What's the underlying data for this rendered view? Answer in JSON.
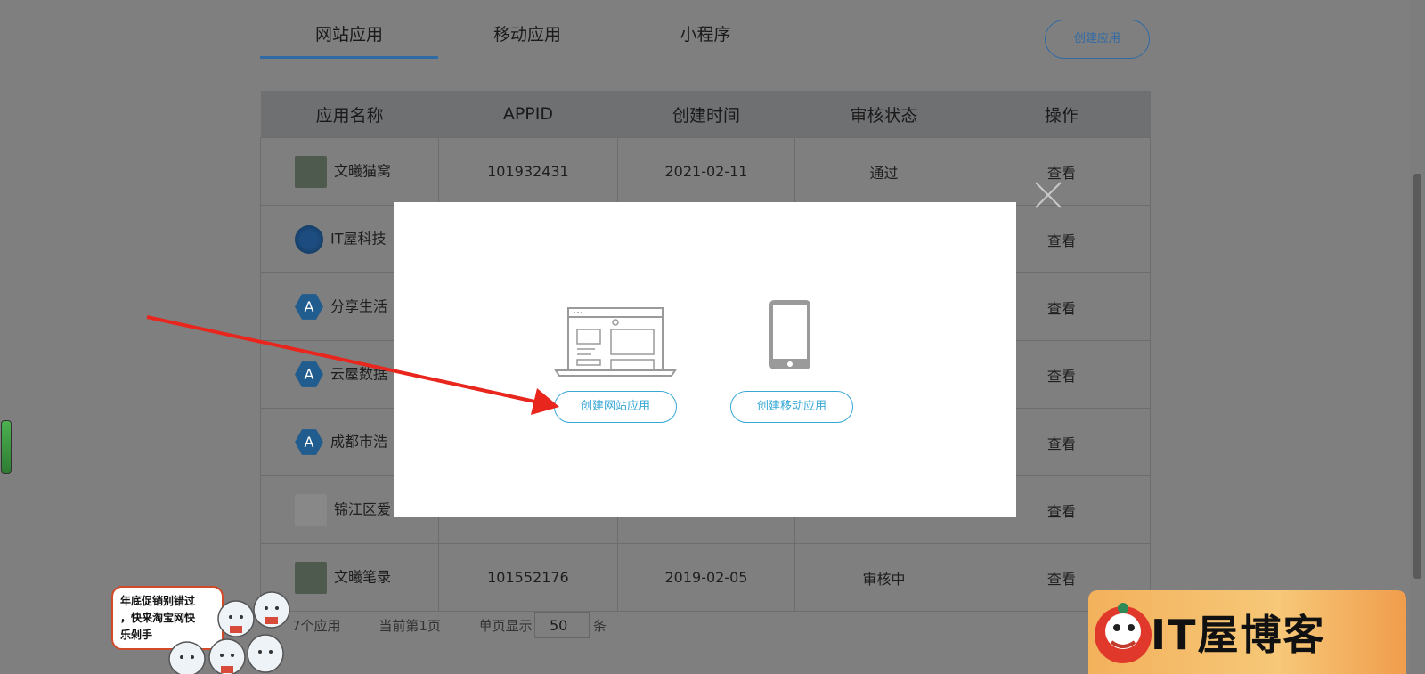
{
  "tabs": [
    {
      "label": "网站应用",
      "active": true
    },
    {
      "label": "移动应用",
      "active": false
    },
    {
      "label": "小程序",
      "active": false
    }
  ],
  "create_app_button": "创建应用",
  "table": {
    "headers": [
      "应用名称",
      "APPID",
      "创建时间",
      "审核状态",
      "操作"
    ],
    "rows": [
      {
        "name": "文曦猫窝",
        "appid": "101932431",
        "created": "2021-02-11",
        "status": "通过",
        "action": "查看"
      },
      {
        "name": "IT屋科技",
        "appid": "",
        "created": "",
        "status": "",
        "action": "查看"
      },
      {
        "name": "分享生活",
        "appid": "",
        "created": "",
        "status": "",
        "action": "查看"
      },
      {
        "name": "云屋数据",
        "appid": "",
        "created": "",
        "status": "",
        "action": "查看"
      },
      {
        "name": "成都市浩",
        "appid": "",
        "created": "",
        "status": "",
        "action": "查看"
      },
      {
        "name": "锦江区爱",
        "appid": "",
        "created": "",
        "status": "",
        "action": "查看"
      },
      {
        "name": "文曦笔录",
        "appid": "101552176",
        "created": "2019-02-05",
        "status": "审核中",
        "action": "查看"
      }
    ]
  },
  "pager": {
    "total": "7个应用",
    "current": "当前第1页",
    "page_size_label": "单页显示",
    "page_size_value": "50",
    "unit": "条"
  },
  "modal": {
    "create_web_button": "创建网站应用",
    "create_mobile_button": "创建移动应用"
  },
  "promo": {
    "line1": "年底促销别错过",
    "line2": "，快来淘宝网快",
    "line3": "乐剁手"
  },
  "banner": {
    "text": "IT屋博客"
  },
  "colors": {
    "accent": "#38a8d6",
    "pass": "#2e7d32",
    "review": "#b35a33"
  }
}
